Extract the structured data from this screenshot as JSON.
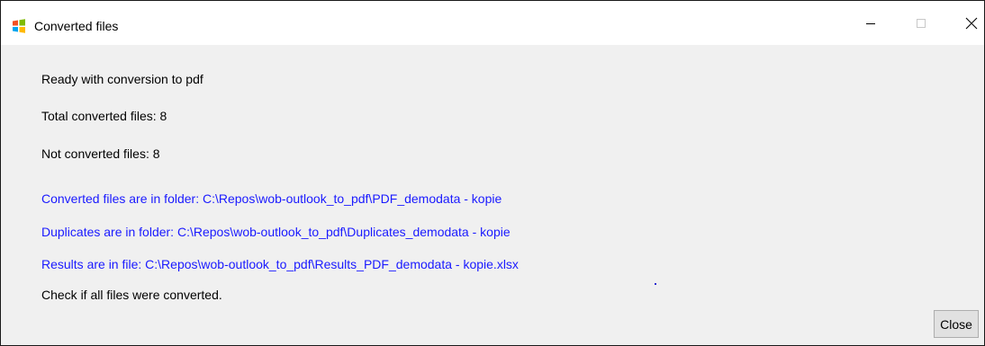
{
  "window": {
    "title": "Converted files",
    "app_icon": "windows-logo-icon",
    "controls": {
      "minimize_icon": "minimize-icon",
      "maximize_icon": "maximize-icon",
      "close_icon": "close-icon"
    }
  },
  "content": {
    "lines": [
      "Ready with conversion to pdf",
      "Total converted files: 8",
      "Not converted files: 8",
      "Converted files are in folder: C:\\Repos\\wob-outlook_to_pdf\\PDF_demodata - kopie",
      "Duplicates are in folder: C:\\Repos\\wob-outlook_to_pdf\\Duplicates_demodata - kopie",
      "Results are in file: C:\\Repos\\wob-outlook_to_pdf\\Results_PDF_demodata - kopie.xlsx",
      "Check if all files were converted."
    ]
  },
  "buttons": {
    "close_label": "Close"
  },
  "colors": {
    "link_text": "#1a1aff",
    "body_text": "#000000",
    "background": "#f0f0f0",
    "titlebar": "#ffffff"
  }
}
